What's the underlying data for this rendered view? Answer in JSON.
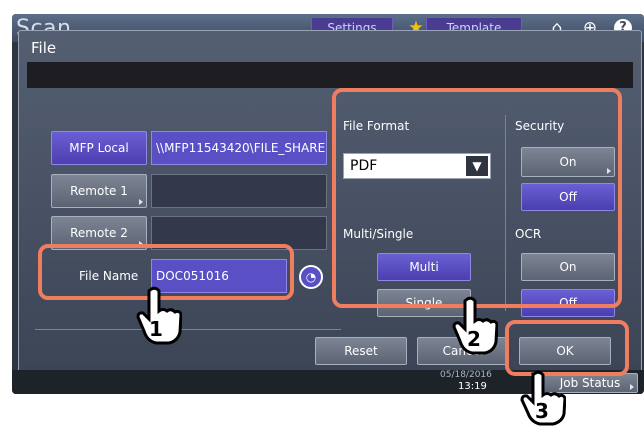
{
  "app": {
    "title": "Scan"
  },
  "topbar": {
    "settings_label": "Settings",
    "template_label": "Template"
  },
  "dialog": {
    "title": "File"
  },
  "destinations": {
    "mfp_local_label": "MFP Local",
    "mfp_local_path": "\\\\MFP11543420\\FILE_SHARE",
    "remote1_label": "Remote 1",
    "remote2_label": "Remote 2",
    "file_name_label": "File Name",
    "file_name_value": "DOC051016"
  },
  "file_format": {
    "label": "File Format",
    "selected": "PDF"
  },
  "multi_single": {
    "label": "Multi/Single",
    "multi": "Multi",
    "single": "Single",
    "selected": "Multi"
  },
  "security": {
    "label": "Security",
    "on": "On",
    "off": "Off",
    "selected": "Off"
  },
  "ocr": {
    "label": "OCR",
    "on": "On",
    "off": "Off",
    "selected": "Off"
  },
  "actions": {
    "reset": "Reset",
    "cancel": "Cancel",
    "ok": "OK"
  },
  "statusbar": {
    "date": "05/18/2016",
    "time": "13:19",
    "job_status": "Job Status"
  },
  "callouts": [
    "1",
    "2",
    "3"
  ],
  "colors": {
    "highlight": "#ef7d5f",
    "selected": "#5a4fc4",
    "panel": "#3b4455"
  }
}
